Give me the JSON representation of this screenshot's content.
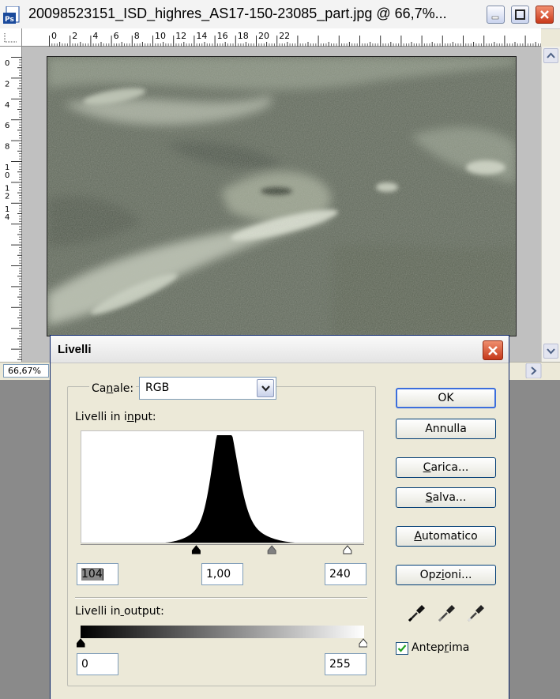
{
  "document": {
    "title": "20098523151_ISD_highres_AS17-150-23085_part.jpg @ 66,7%...",
    "zoom": "66,67%",
    "ruler_h_labels": [
      "0",
      "2",
      "4",
      "6",
      "8",
      "10",
      "12",
      "14",
      "16",
      "18",
      "20",
      "22"
    ],
    "ruler_v_labels": [
      "0",
      "2",
      "4",
      "6",
      "8",
      "10",
      "12",
      "14"
    ]
  },
  "dialog": {
    "title": "Livelli",
    "channel_label": "Canale:",
    "channel_value": "RGB",
    "input_label": "Livelli in input:",
    "input_black": "104",
    "input_gamma": "1,00",
    "input_white": "240",
    "output_label": "Livelli in output:",
    "output_black": "0",
    "output_white": "255",
    "buttons": {
      "ok": "OK",
      "annulla": "Annulla",
      "carica": "Carica...",
      "salva": "Salva...",
      "automatico": "Automatico",
      "opzioni": "Opzioni..."
    },
    "preview_label": "Anteprima",
    "preview_checked": true
  },
  "chart_data": {
    "type": "area",
    "x_range": [
      0,
      255
    ],
    "histogram_peak_level": 128,
    "input_black_level": 104,
    "input_gamma_level": 172,
    "input_white_level": 240,
    "output_black_level": 0,
    "output_white_level": 255
  },
  "colors": {
    "title_active": "#0a246a",
    "close_red": "#c8391b",
    "face": "#ece9d8"
  }
}
